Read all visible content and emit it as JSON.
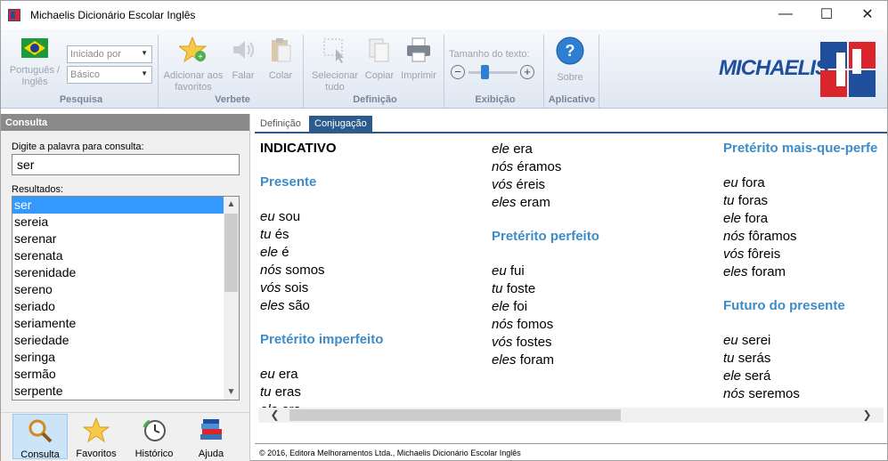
{
  "window": {
    "title": "Michaelis Dicionário Escolar Inglês",
    "minimize": "—",
    "maximize": "☐",
    "close": "✕"
  },
  "ribbon": {
    "language_label": "Português / Inglês",
    "level_select_placeholder": "Iniciado por",
    "level_select_value": "Básico",
    "group_pesquisa": "Pesquisa",
    "add_fav_label": "Adicionar aos favoritos",
    "speak_label": "Falar",
    "paste_label": "Colar",
    "group_verbete": "Verbete",
    "select_all_label": "Selecionar tudo",
    "copy_label": "Copiar",
    "print_label": "Imprimir",
    "group_definicao": "Definição",
    "text_size_label": "Tamanho do texto:",
    "text_size_level": 0.3,
    "group_exibicao": "Exibição",
    "about_label": "Sobre",
    "group_aplicativo": "Aplicativo",
    "logo_text": "MICHAELIS"
  },
  "left": {
    "header": "Consulta",
    "prompt": "Digite a palavra para consulta:",
    "query": "ser",
    "results_label": "Resultados:",
    "results": [
      "ser",
      "sereia",
      "serenar",
      "serenata",
      "serenidade",
      "sereno",
      "seriado",
      "seriamente",
      "seriedade",
      "seringa",
      "sermão",
      "serpente"
    ],
    "nav": [
      "Consulta",
      "Favoritos",
      "Histórico",
      "Ajuda"
    ]
  },
  "tabs": [
    "Definição",
    "Conjugação"
  ],
  "conj": {
    "mood": "INDICATIVO",
    "presente_title": "Presente",
    "presente": [
      [
        "eu",
        "sou"
      ],
      [
        "tu",
        "és"
      ],
      [
        "ele",
        "é"
      ],
      [
        "nós",
        "somos"
      ],
      [
        "vós",
        "sois"
      ],
      [
        "eles",
        "são"
      ]
    ],
    "imperfeito_title": "Pretérito imperfeito",
    "imperfeito": [
      [
        "eu",
        "era"
      ],
      [
        "tu",
        "eras"
      ],
      [
        "ele",
        "era"
      ],
      [
        "nós",
        "éramos"
      ],
      [
        "vós",
        "éreis"
      ],
      [
        "eles",
        "eram"
      ]
    ],
    "perfeito_title": "Pretérito perfeito",
    "perfeito": [
      [
        "eu",
        "fui"
      ],
      [
        "tu",
        "foste"
      ],
      [
        "ele",
        "foi"
      ],
      [
        "nós",
        "fomos"
      ],
      [
        "vós",
        "fostes"
      ],
      [
        "eles",
        "foram"
      ]
    ],
    "mais_que_title": "Pretérito mais-que-perfe",
    "mais_que": [
      [
        "eu",
        "fora"
      ],
      [
        "tu",
        "foras"
      ],
      [
        "ele",
        "fora"
      ],
      [
        "nós",
        "fôramos"
      ],
      [
        "vós",
        "fôreis"
      ],
      [
        "eles",
        "foram"
      ]
    ],
    "futuro_title": "Futuro do presente",
    "futuro": [
      [
        "eu",
        "serei"
      ],
      [
        "tu",
        "serás"
      ],
      [
        "ele",
        "será"
      ],
      [
        "nós",
        "seremos"
      ]
    ]
  },
  "footer": "© 2016, Editora Melhoramentos Ltda., Michaelis Dicionário Escolar Inglês"
}
